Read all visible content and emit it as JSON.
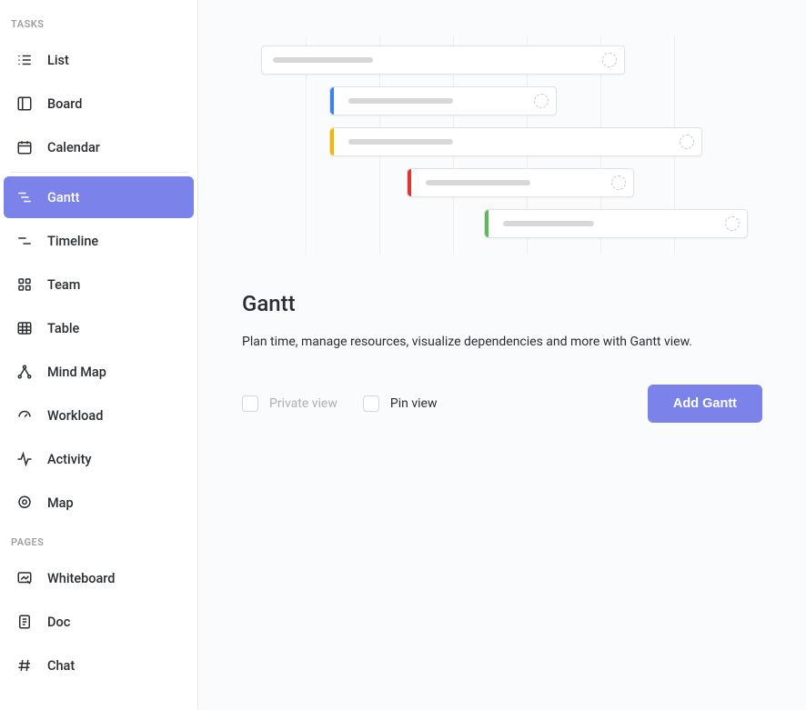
{
  "sidebar": {
    "sections": {
      "tasks": {
        "header": "TASKS",
        "items": [
          {
            "label": "List"
          },
          {
            "label": "Board"
          },
          {
            "label": "Calendar"
          },
          {
            "label": "Gantt",
            "active": true
          },
          {
            "label": "Timeline"
          },
          {
            "label": "Team"
          },
          {
            "label": "Table"
          },
          {
            "label": "Mind Map"
          },
          {
            "label": "Workload"
          },
          {
            "label": "Activity"
          },
          {
            "label": "Map"
          }
        ]
      },
      "pages": {
        "header": "PAGES",
        "items": [
          {
            "label": "Whiteboard"
          },
          {
            "label": "Doc"
          },
          {
            "label": "Chat"
          }
        ]
      }
    }
  },
  "main": {
    "title": "Gantt",
    "description": "Plan time, manage resources, visualize dependencies and more with Gantt view.",
    "private_view_label": "Private view",
    "pin_view_label": "Pin view",
    "add_button_label": "Add Gantt"
  },
  "colors": {
    "accent": "#7b83eb",
    "bar_blue": "#3b82f6",
    "bar_yellow": "#f5b800",
    "bar_red": "#e0342c",
    "bar_green": "#5cb85c"
  }
}
